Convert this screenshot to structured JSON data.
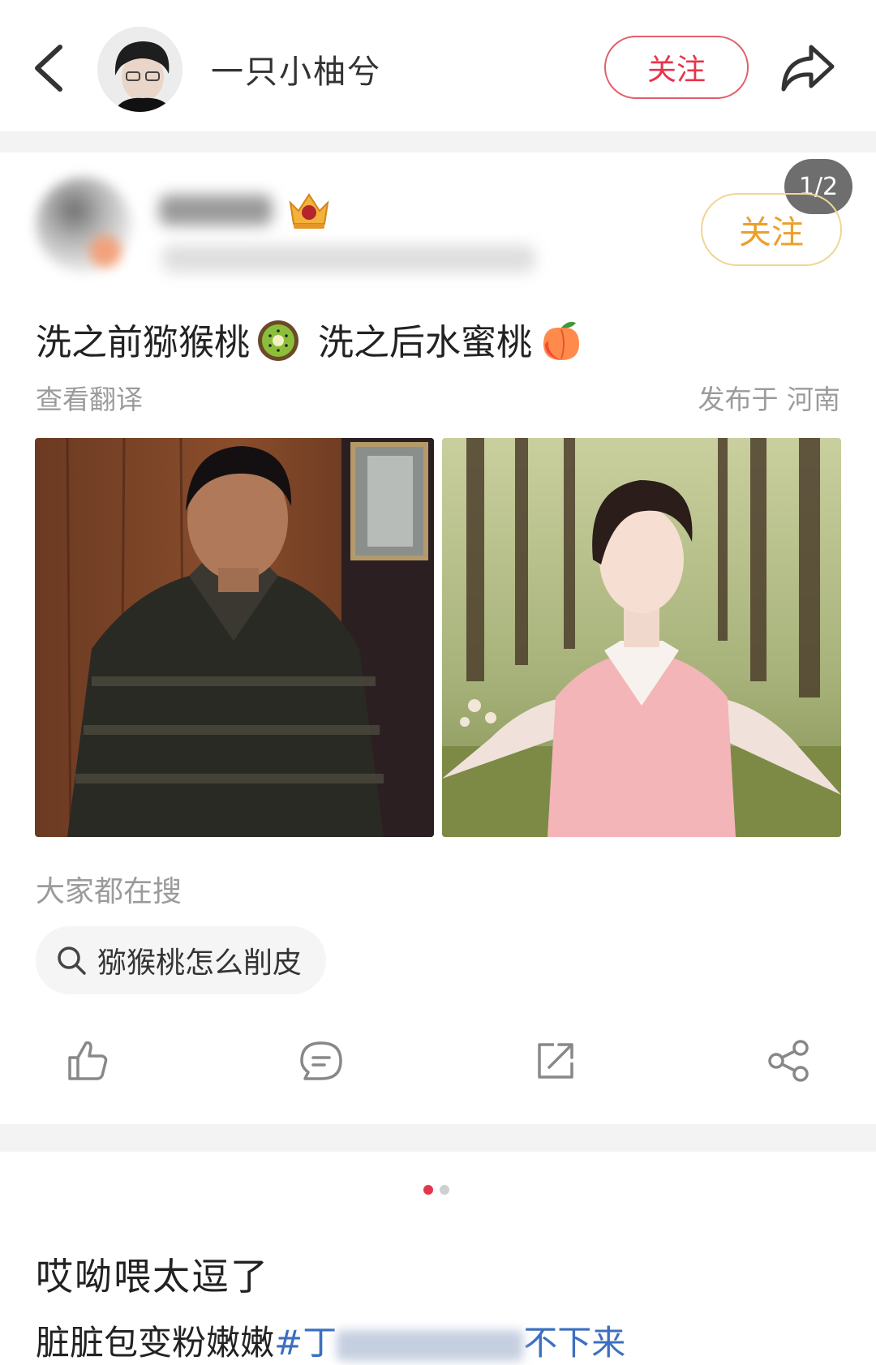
{
  "header": {
    "back_icon": "chevron-left-icon",
    "user_name": "一只小柚兮",
    "follow_label": "关注",
    "share_icon": "forward-arrow-icon"
  },
  "post": {
    "page_indicator": "1/2",
    "follow_label": "关注",
    "text_part1": "洗之前猕猴桃",
    "text_part2": "洗之后水蜜桃",
    "emoji_1": "kiwi-emoji",
    "emoji_2": "peach-emoji",
    "translate_label": "查看翻译",
    "publish_info": "发布于 河南",
    "search_hint": "大家都在搜",
    "search_chip": "猕猴桃怎么削皮",
    "actions": [
      "like-icon",
      "comment-icon",
      "repost-icon",
      "share-icon"
    ]
  },
  "next_post": {
    "title": "哎呦喂太逗了",
    "line_prefix": "脏脏包变粉嫩嫩",
    "hashtag_start": "#丁",
    "hashtag_end": "不下来"
  },
  "colors": {
    "accent_red": "#e8344a",
    "accent_gold": "#eba02a",
    "link_blue": "#3c6fbf",
    "muted_gray": "#9b9b9b"
  }
}
